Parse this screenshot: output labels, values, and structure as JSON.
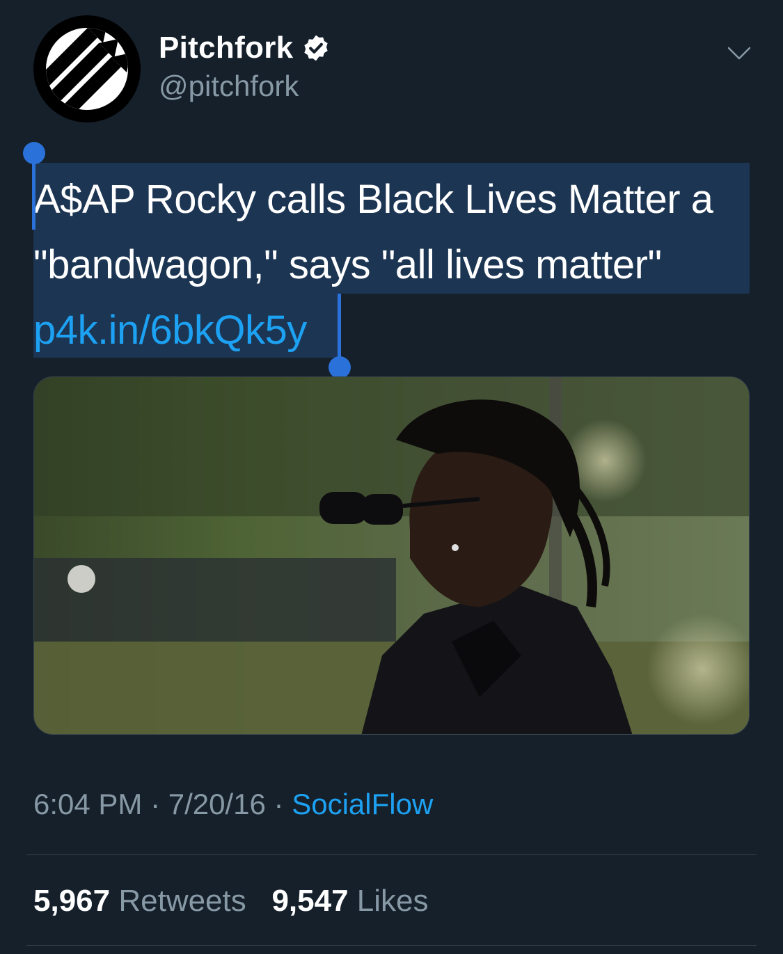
{
  "author": {
    "display_name": "Pitchfork",
    "handle": "@pitchfork",
    "verified": true,
    "avatar_icon": "pitchfork-logo-icon"
  },
  "tweet": {
    "text": "A$AP Rocky calls Black Lives Matter a \"bandwagon,\" says \"all lives matter\"",
    "link": "p4k.in/6bkQk5y"
  },
  "meta": {
    "time": "6:04 PM",
    "separator": " · ",
    "date": "7/20/16",
    "source": "SocialFlow"
  },
  "stats": {
    "retweets_count": "5,967",
    "retweets_label": "Retweets",
    "likes_count": "9,547",
    "likes_label": "Likes"
  },
  "colors": {
    "background": "#15202b",
    "link": "#1da1f2",
    "secondary_text": "#8899a6",
    "selection": "#1c3553",
    "selection_handle": "#2a72d9"
  }
}
